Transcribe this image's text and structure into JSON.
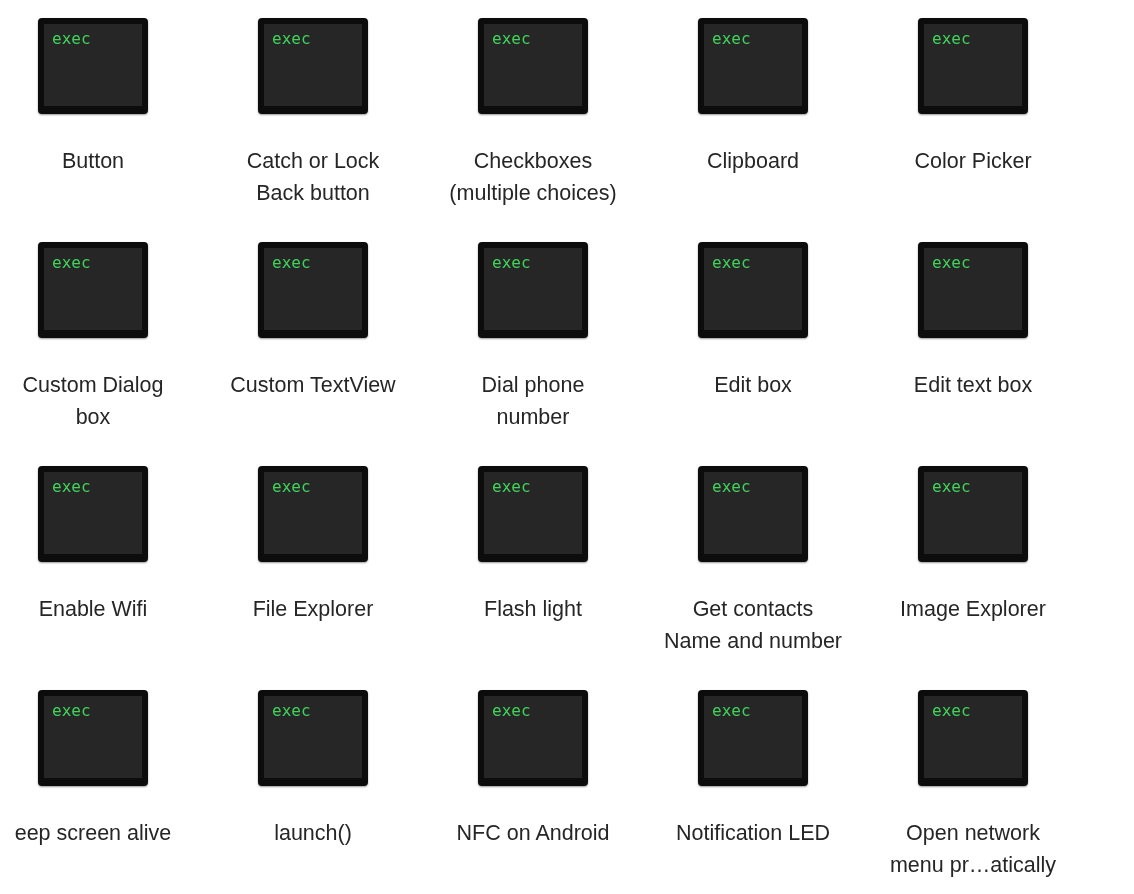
{
  "items": [
    {
      "name": "Button",
      "icon_text": "exec"
    },
    {
      "name": "Catch or Lock\nBack button",
      "icon_text": "exec"
    },
    {
      "name": "Checkboxes\n(multiple choices)",
      "icon_text": "exec"
    },
    {
      "name": "Clipboard",
      "icon_text": "exec"
    },
    {
      "name": "Color Picker",
      "icon_text": "exec"
    },
    {
      "name": "Custom Dialog\nbox",
      "icon_text": "exec"
    },
    {
      "name": "Custom TextView",
      "icon_text": "exec"
    },
    {
      "name": "Dial phone\nnumber",
      "icon_text": "exec"
    },
    {
      "name": "Edit box",
      "icon_text": "exec"
    },
    {
      "name": "Edit text box",
      "icon_text": "exec"
    },
    {
      "name": "Enable Wifi",
      "icon_text": "exec"
    },
    {
      "name": "File Explorer",
      "icon_text": "exec"
    },
    {
      "name": "Flash light",
      "icon_text": "exec"
    },
    {
      "name": "Get contacts\nName and number",
      "icon_text": "exec"
    },
    {
      "name": "Image Explorer",
      "icon_text": "exec"
    },
    {
      "name": "eep screen alive",
      "icon_text": "exec"
    },
    {
      "name": "launch()",
      "icon_text": "exec"
    },
    {
      "name": "NFC on Android",
      "icon_text": "exec"
    },
    {
      "name": "Notification LED",
      "icon_text": "exec"
    },
    {
      "name": "Open network\nmenu pr…atically",
      "icon_text": "exec"
    }
  ]
}
